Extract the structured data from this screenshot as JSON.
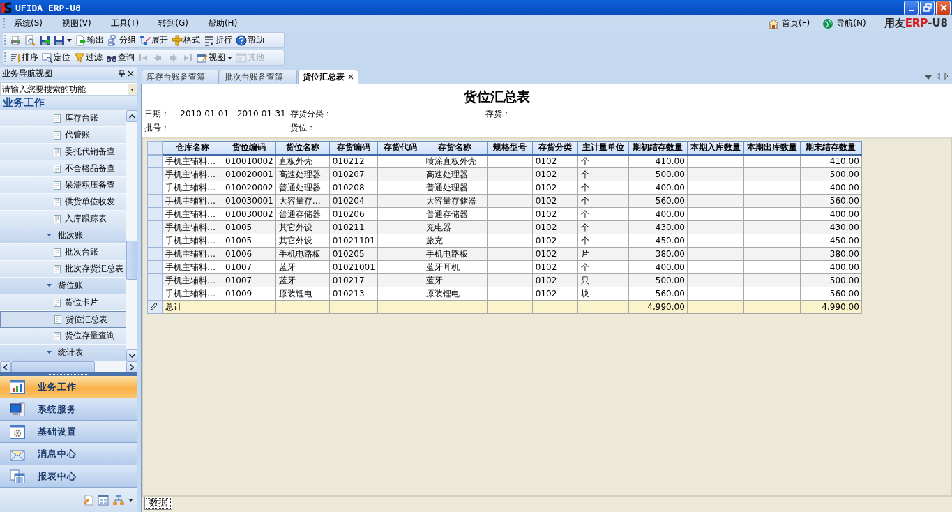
{
  "window": {
    "title": "UFIDA ERP-U8"
  },
  "menu": [
    "系统(S)",
    "视图(V)",
    "工具(T)",
    "转到(G)",
    "帮助(H)"
  ],
  "quick_links": [
    {
      "label": "首页(F)",
      "kind": "home"
    },
    {
      "label": "导航(N)",
      "kind": "globe"
    }
  ],
  "brand": [
    "用友",
    "ERP",
    "-U8"
  ],
  "toolbar_1": [
    {
      "kind": "print"
    },
    {
      "kind": "preview"
    },
    {
      "kind": "save-green"
    },
    {
      "kind": "save"
    },
    {
      "kind": "caret"
    },
    {
      "kind": "export",
      "label": "输出"
    },
    {
      "kind": "group",
      "label": "分组"
    },
    {
      "kind": "expand",
      "label": "展开"
    },
    {
      "kind": "format",
      "label": "格式"
    },
    {
      "kind": "wrap",
      "label": "折行"
    },
    {
      "kind": "help",
      "label": "帮助"
    }
  ],
  "toolbar_2": [
    {
      "kind": "sort",
      "label": "排序",
      "disabled": false
    },
    {
      "kind": "locate",
      "label": "定位",
      "disabled": false
    },
    {
      "kind": "filter",
      "label": "过滤",
      "disabled": false
    },
    {
      "kind": "query",
      "label": "查询",
      "disabled": false
    },
    {
      "kind": "first",
      "disabled": true
    },
    {
      "kind": "prev",
      "disabled": true
    },
    {
      "kind": "next",
      "disabled": true
    },
    {
      "kind": "last",
      "disabled": true
    },
    {
      "kind": "view",
      "label": "视图",
      "disabled": false
    },
    {
      "kind": "caret",
      "disabled": false
    },
    {
      "kind": "other",
      "label": "其他",
      "disabled": true
    }
  ],
  "nav_panel": {
    "title": "业务导航视图",
    "search_placeholder": "请输入您要搜索的功能",
    "section": "业务工作",
    "tree": [
      {
        "children": [
          {
            "label": "库存台账",
            "selected": false
          },
          {
            "label": "代管账",
            "selected": false
          },
          {
            "label": "委托代销备查",
            "selected": false
          },
          {
            "label": "不合格品备查",
            "selected": false
          },
          {
            "label": "呆滞积压备查",
            "selected": false
          },
          {
            "label": "供货单位收发",
            "selected": false
          },
          {
            "label": "入库跟踪表",
            "selected": false
          }
        ]
      },
      {
        "label": "批次账",
        "expanded": true,
        "children": [
          {
            "label": "批次台账",
            "selected": false
          },
          {
            "label": "批次存货汇总表",
            "selected": false
          }
        ]
      },
      {
        "label": "货位账",
        "expanded": true,
        "children": [
          {
            "label": "货位卡片",
            "selected": false
          },
          {
            "label": "货位汇总表",
            "selected": true
          },
          {
            "label": "货位存量查询",
            "selected": false
          }
        ]
      },
      {
        "label": "统计表",
        "expanded": true
      }
    ]
  },
  "modules": [
    {
      "label": "业务工作",
      "kind": "chart",
      "selected": true
    },
    {
      "label": "系统服务",
      "kind": "monitor",
      "selected": false
    },
    {
      "label": "基础设置",
      "kind": "settings",
      "selected": false
    },
    {
      "label": "消息中心",
      "kind": "mail",
      "selected": false
    },
    {
      "label": "报表中心",
      "kind": "report",
      "selected": false
    }
  ],
  "doc_tabs": [
    {
      "label": "库存台账备查簿",
      "selected": false
    },
    {
      "label": "批次台账备查簿",
      "selected": false
    },
    {
      "label": "货位汇总表",
      "selected": true
    }
  ],
  "report": {
    "title": "货位汇总表",
    "filters": [
      [
        {
          "label": "日期：",
          "value": "2010-01-01 - 2010-01-31"
        },
        {
          "label": "存货分类：",
          "value": "—"
        },
        {
          "label": "存货：",
          "value": "—"
        }
      ],
      [
        {
          "label": "批号：",
          "value": "—"
        },
        {
          "label": "货位：",
          "value": "—"
        }
      ]
    ]
  },
  "table": {
    "columns": {
      "warehouse": {
        "label": "仓库名称"
      },
      "bin_code": {
        "label": "货位编码"
      },
      "bin_name": {
        "label": "货位名称"
      },
      "item_code": {
        "label": "存货编码"
      },
      "item_alias": {
        "label": "存货代码"
      },
      "item_name": {
        "label": "存货名称"
      },
      "spec": {
        "label": "规格型号"
      },
      "item_class": {
        "label": "存货分类"
      },
      "unit": {
        "label": "主计量单位"
      },
      "opening_qty": {
        "label": "期初结存数量",
        "kind": "number"
      },
      "in_qty": {
        "label": "本期入库数量"
      },
      "out_qty": {
        "label": "本期出库数量"
      },
      "closing_qty": {
        "label": "期末结存数量",
        "kind": "number"
      }
    },
    "rows": [
      {
        "warehouse": "手机主辅料…",
        "bin_code": "010010002",
        "bin_name": "直板外壳",
        "item_code": "010212",
        "item_name": "喷涂直板外壳",
        "item_class": "0102",
        "unit": "个",
        "opening_qty": "410.00",
        "closing_qty": "410.00"
      },
      {
        "warehouse": "手机主辅料…",
        "bin_code": "010020001",
        "bin_name": "高速处理器",
        "item_code": "010207",
        "item_name": "高速处理器",
        "item_class": "0102",
        "unit": "个",
        "opening_qty": "500.00",
        "closing_qty": "500.00"
      },
      {
        "warehouse": "手机主辅料…",
        "bin_code": "010020002",
        "bin_name": "普通处理器",
        "item_code": "010208",
        "item_name": "普通处理器",
        "item_class": "0102",
        "unit": "个",
        "opening_qty": "400.00",
        "closing_qty": "400.00"
      },
      {
        "warehouse": "手机主辅料…",
        "bin_code": "010030001",
        "bin_name": "大容量存…",
        "item_code": "010204",
        "item_name": "大容量存储器",
        "item_class": "0102",
        "unit": "个",
        "opening_qty": "560.00",
        "closing_qty": "560.00"
      },
      {
        "warehouse": "手机主辅料…",
        "bin_code": "010030002",
        "bin_name": "普通存储器",
        "item_code": "010206",
        "item_name": "普通存储器",
        "item_class": "0102",
        "unit": "个",
        "opening_qty": "400.00",
        "closing_qty": "400.00"
      },
      {
        "warehouse": "手机主辅料…",
        "bin_code": "01005",
        "bin_name": "其它外设",
        "item_code": "010211",
        "item_name": "充电器",
        "item_class": "0102",
        "unit": "个",
        "opening_qty": "430.00",
        "closing_qty": "430.00"
      },
      {
        "warehouse": "手机主辅料…",
        "bin_code": "01005",
        "bin_name": "其它外设",
        "item_code": "01021101",
        "item_name": "旅充",
        "item_class": "0102",
        "unit": "个",
        "opening_qty": "450.00",
        "closing_qty": "450.00"
      },
      {
        "warehouse": "手机主辅料…",
        "bin_code": "01006",
        "bin_name": "手机电路板",
        "item_code": "010205",
        "item_name": "手机电路板",
        "item_class": "0102",
        "unit": "片",
        "opening_qty": "380.00",
        "closing_qty": "380.00"
      },
      {
        "warehouse": "手机主辅料…",
        "bin_code": "01007",
        "bin_name": "蓝牙",
        "item_code": "01021001",
        "item_name": "蓝牙耳机",
        "item_class": "0102",
        "unit": "个",
        "opening_qty": "400.00",
        "closing_qty": "400.00"
      },
      {
        "warehouse": "手机主辅料…",
        "bin_code": "01007",
        "bin_name": "蓝牙",
        "item_code": "010217",
        "item_name": "蓝牙",
        "item_class": "0102",
        "unit": "只",
        "opening_qty": "500.00",
        "closing_qty": "500.00"
      },
      {
        "warehouse": "手机主辅料…",
        "bin_code": "01009",
        "bin_name": "原装锂电",
        "item_code": "010213",
        "item_name": "原装锂电",
        "item_class": "0102",
        "unit": "块",
        "opening_qty": "560.00",
        "closing_qty": "560.00"
      }
    ],
    "total": {
      "warehouse": "总计",
      "opening_qty": "4,990.00",
      "closing_qty": "4,990.00"
    }
  },
  "sheet_tabs": [
    {
      "label": "数据",
      "selected": true
    }
  ]
}
